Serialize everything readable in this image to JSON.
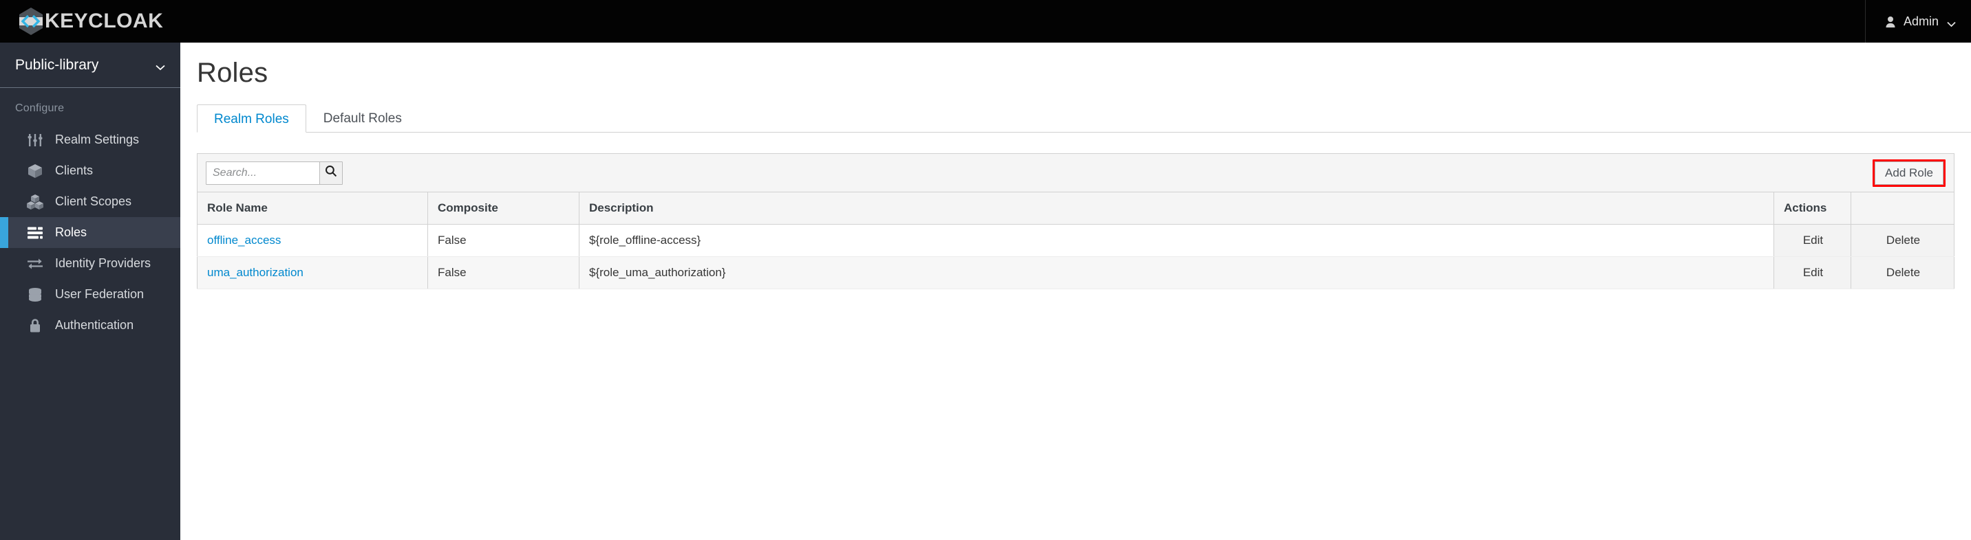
{
  "topbar": {
    "brand_name": "KEYCLOAK",
    "logo_icon": "keycloak-hexagon-logo",
    "user_label": "Admin",
    "user_icon": "person-icon",
    "caret_icon": "chevron-down-icon"
  },
  "sidebar": {
    "realm": {
      "name": "Public-library",
      "caret_icon": "chevron-down-icon"
    },
    "section_title": "Configure",
    "items": [
      {
        "label": "Realm Settings",
        "icon": "sliders-icon",
        "active": false
      },
      {
        "label": "Clients",
        "icon": "cube-icon",
        "active": false
      },
      {
        "label": "Client Scopes",
        "icon": "cubes-icon",
        "active": false
      },
      {
        "label": "Roles",
        "icon": "list-rows-icon",
        "active": true
      },
      {
        "label": "Identity Providers",
        "icon": "exchange-icon",
        "active": false
      },
      {
        "label": "User Federation",
        "icon": "database-icon",
        "active": false
      },
      {
        "label": "Authentication",
        "icon": "lock-icon",
        "active": false
      }
    ]
  },
  "main": {
    "page_title": "Roles",
    "tabs": [
      {
        "label": "Realm Roles",
        "active": true
      },
      {
        "label": "Default Roles",
        "active": false
      }
    ],
    "toolbar": {
      "search_placeholder": "Search...",
      "search_value": "",
      "search_icon": "magnifier-icon",
      "add_role_label": "Add Role",
      "highlight_color": "#ff0000"
    },
    "table": {
      "columns": [
        "Role Name",
        "Composite",
        "Description",
        "Actions"
      ],
      "rows": [
        {
          "role_name": "offline_access",
          "composite": "False",
          "description": "${role_offline-access}",
          "edit_label": "Edit",
          "delete_label": "Delete"
        },
        {
          "role_name": "uma_authorization",
          "composite": "False",
          "description": "${role_uma_authorization}",
          "edit_label": "Edit",
          "delete_label": "Delete"
        }
      ]
    }
  },
  "colors": {
    "topbar_bg": "#030303",
    "sidebar_bg": "#292e39",
    "active_nav_bar": "#39a5dc",
    "link_blue": "#0088ce",
    "annotation_red": "#ff0000"
  }
}
